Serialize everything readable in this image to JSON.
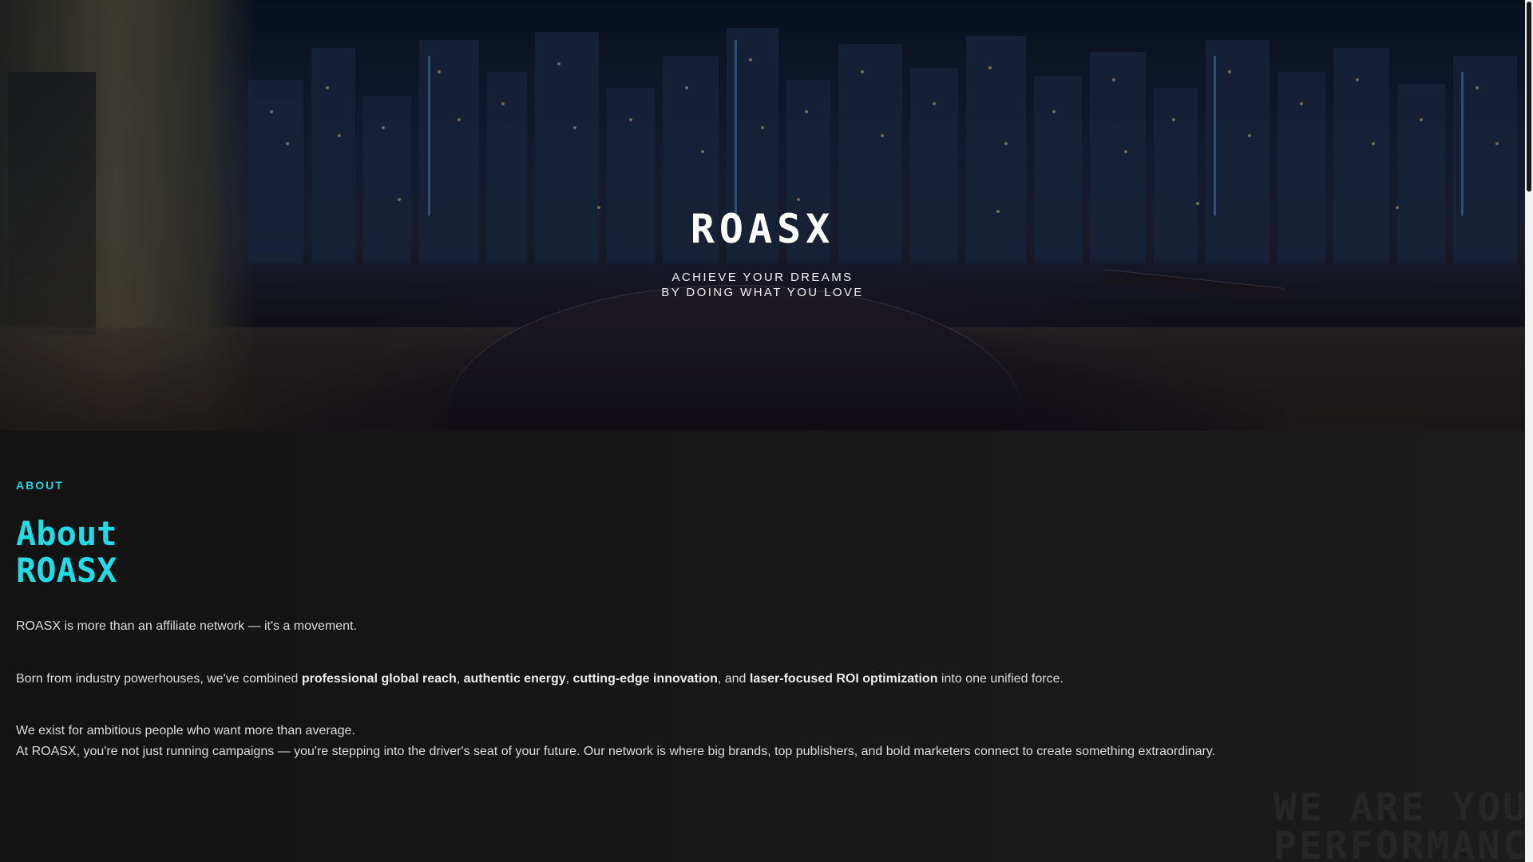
{
  "hero": {
    "brand": "ROASX",
    "tagline_line1": "ACHIEVE YOUR DREAMS",
    "tagline_line2": "BY DOING WHAT YOU LOVE"
  },
  "about": {
    "eyebrow": "ABOUT",
    "title_line1": "About",
    "title_line2": "ROASX",
    "p1": "ROASX is more than an affiliate network — it's a movement.",
    "p2": {
      "prefix": "Born from industry powerhouses, we've combined ",
      "b1": "professional global reach",
      "sep1": ", ",
      "b2": "authentic energy",
      "sep2": ", ",
      "b3": "cutting-edge innovation",
      "sep3": ", and ",
      "b4": "laser-focused ROI optimization",
      "suffix": " into one unified force."
    },
    "p3": "We exist for ambitious people who want more than average.",
    "p4": "At ROASX, you're not just running campaigns — you're stepping into the driver's seat of your future. Our network is where big brands, top publishers, and bold marketers connect to create something extraordinary.",
    "watermark_line1": "WE ARE YOUR",
    "watermark_line2": "PERFORMANCE"
  },
  "colors": {
    "accent": "#22dbe6",
    "background": "#141414"
  }
}
